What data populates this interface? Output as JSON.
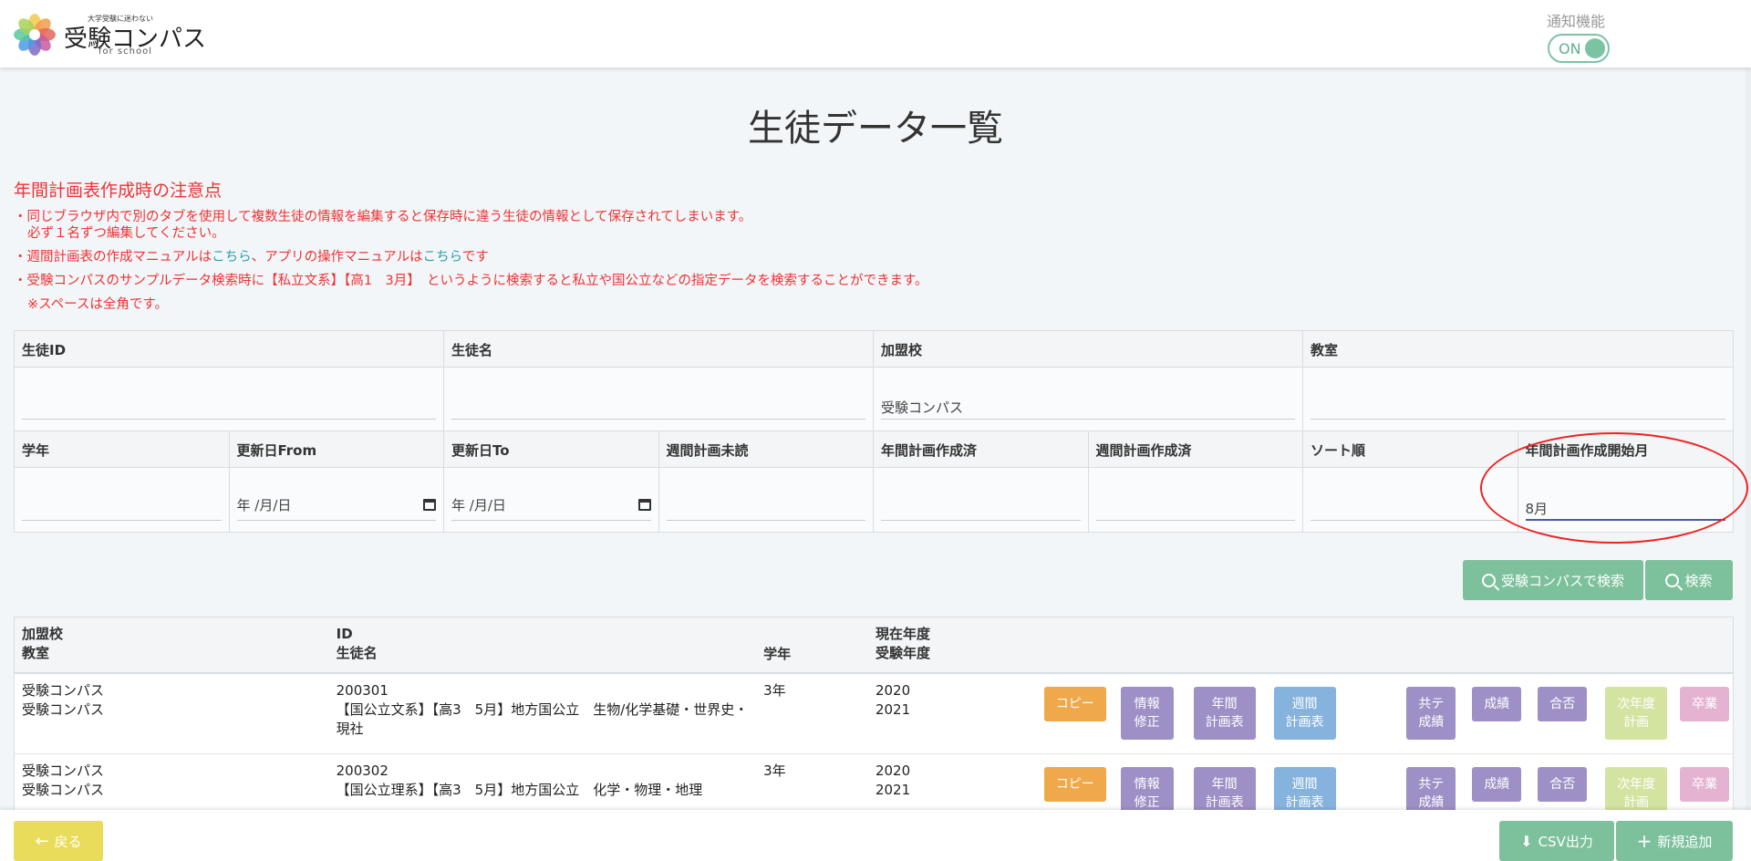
{
  "header": {
    "logo_tagline": "大学受験に迷わない",
    "logo_name": "受験コンパス",
    "logo_sub": "for school",
    "notify_label": "通知機能",
    "toggle_text": "ON"
  },
  "page_title": "生徒データ一覧",
  "notice": {
    "title": "年間計画表作成時の注意点",
    "line1": "・同じブラウザ内で別のタブを使用して複数生徒の情報を編集すると保存時に違う生徒の情報として保存されてしまいます。",
    "line1b": "必ず１名ずつ編集してください。",
    "line2_pre": "・週間計画表の作成マニュアルは",
    "link1": "こちら",
    "line2_mid": "、アプリの操作マニュアルは",
    "link2": "こちら",
    "line2_post": "です",
    "line3": "・受験コンパスのサンプルデータ検索時に【私立文系】【高1　3月】　というように検索すると私立や国公立などの指定データを検索することができます。",
    "line3b": "※スペースは全角です。"
  },
  "filters": {
    "row1_labels": [
      "生徒ID",
      "生徒名",
      "加盟校",
      "教室"
    ],
    "row1_values": [
      "",
      "",
      "受験コンパス",
      ""
    ],
    "row2_labels": [
      "学年",
      "更新日From",
      "更新日To",
      "週間計画未読",
      "年間計画作成済",
      "週間計画作成済",
      "ソート順",
      "年間計画作成開始月"
    ],
    "date_placeholder": "年 /月/日",
    "start_month_value": "8月"
  },
  "search": {
    "compass_label": "受験コンパスで検索",
    "search_label": "検索"
  },
  "table": {
    "headers": {
      "school": "加盟校",
      "classroom": "教室",
      "id": "ID",
      "name": "生徒名",
      "grade": "学年",
      "current_year": "現在年度",
      "exam_year": "受験年度"
    },
    "rows": [
      {
        "school": "受験コンパス",
        "classroom": "受験コンパス",
        "id": "200301",
        "name": "【国公立文系】【高3　5月】地方国公立　生物/化学基礎・世界史・現社",
        "grade": "3年",
        "current_year": "2020",
        "exam_year": "2021"
      },
      {
        "school": "受験コンパス",
        "classroom": "受験コンパス",
        "id": "200302",
        "name": "【国公立理系】【高3　5月】地方国公立　化学・物理・地理",
        "grade": "3年",
        "current_year": "2020",
        "exam_year": "2021"
      }
    ],
    "actions": {
      "copy": "コピー",
      "edit_1": "情報",
      "edit_2": "修正",
      "annual_1": "年間",
      "annual_2": "計画表",
      "weekly_1": "週間",
      "weekly_2": "計画表",
      "common_1": "共テ",
      "common_2": "成績",
      "grades": "成績",
      "result": "合否",
      "next_1": "次年度",
      "next_2": "計画",
      "graduate": "卒業"
    }
  },
  "footer": {
    "back_label": "戻る",
    "csv_label": "CSV出力",
    "new_label": "新規追加"
  },
  "colors": {
    "accent_green": "#7cc19b",
    "notice_red": "#e33333",
    "back_yellow": "#e9dc5a"
  }
}
